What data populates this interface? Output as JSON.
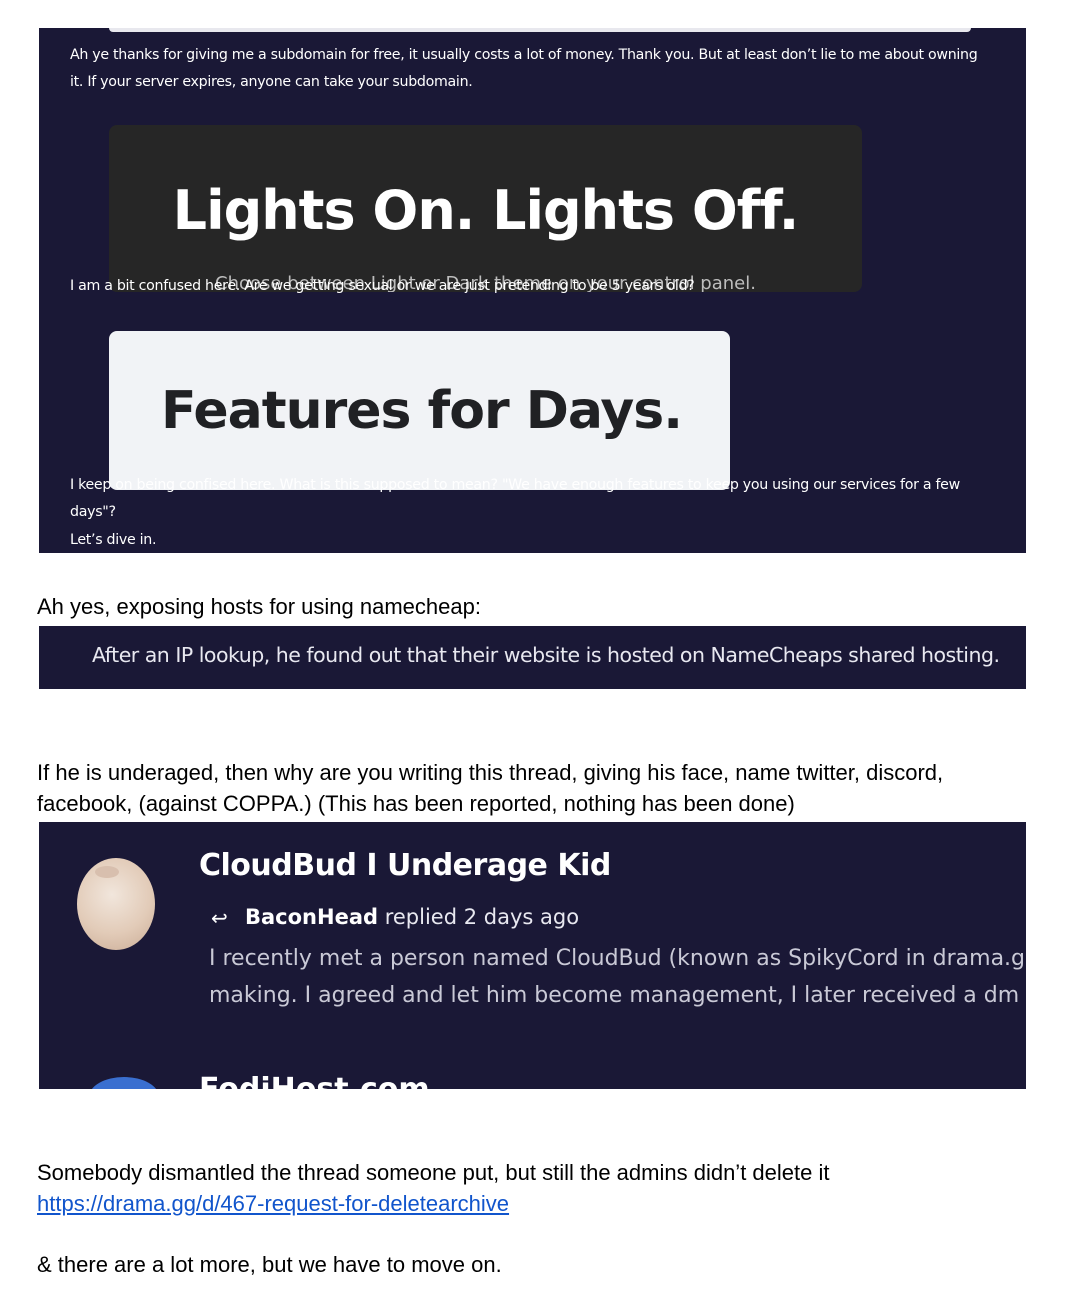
{
  "panel1": {
    "para1": "Ah ye thanks for giving me a subdomain for free, it usually costs a lot of money. Thank you. But at least don’t lie to me about owning it. If your server expires, anyone can take your subdomain.",
    "card1_title": "Lights On. Lights Off.",
    "card1_sub": "Choose between Light or Dark theme on your control panel.",
    "para2": "I am a bit confused here. Are we getting sexual or we are just pretending to be 5 years old?",
    "card2_title": "Features for Days.",
    "para3": "I keep on being confised here. What is this supposed to mean? \"We have enough features to keep you using our services for a few days\"?",
    "para4": "Let’s dive in."
  },
  "doc1": "Ah yes, exposing hosts for using namecheap:",
  "panel2": {
    "text": "After an IP lookup, he found out that their website is hosted on NameCheaps shared hosting."
  },
  "doc2": "If he is underaged, then why are you writing this thread, giving his face, name twitter, discord, facebook, (against COPPA.) (This has been reported, nothing has been done)",
  "panel3": {
    "thread_title": "CloudBud I Underage Kid",
    "author": "BaconHead",
    "meta": "replied 2 days ago",
    "excerpt1": "I recently met a person named CloudBud (known as SpikyCord in drama.gg). He a",
    "excerpt2": "making. I agreed and let him become management, I later received a dm from o..",
    "next_title": "FodiHost.com"
  },
  "doc3": "Somebody dismantled the thread someone put, but still the admins didn’t delete it",
  "doc3_link": "https://drama.gg/d/467-request-for-deletearchive",
  "doc4": "& there are a lot more, but we have to move on."
}
